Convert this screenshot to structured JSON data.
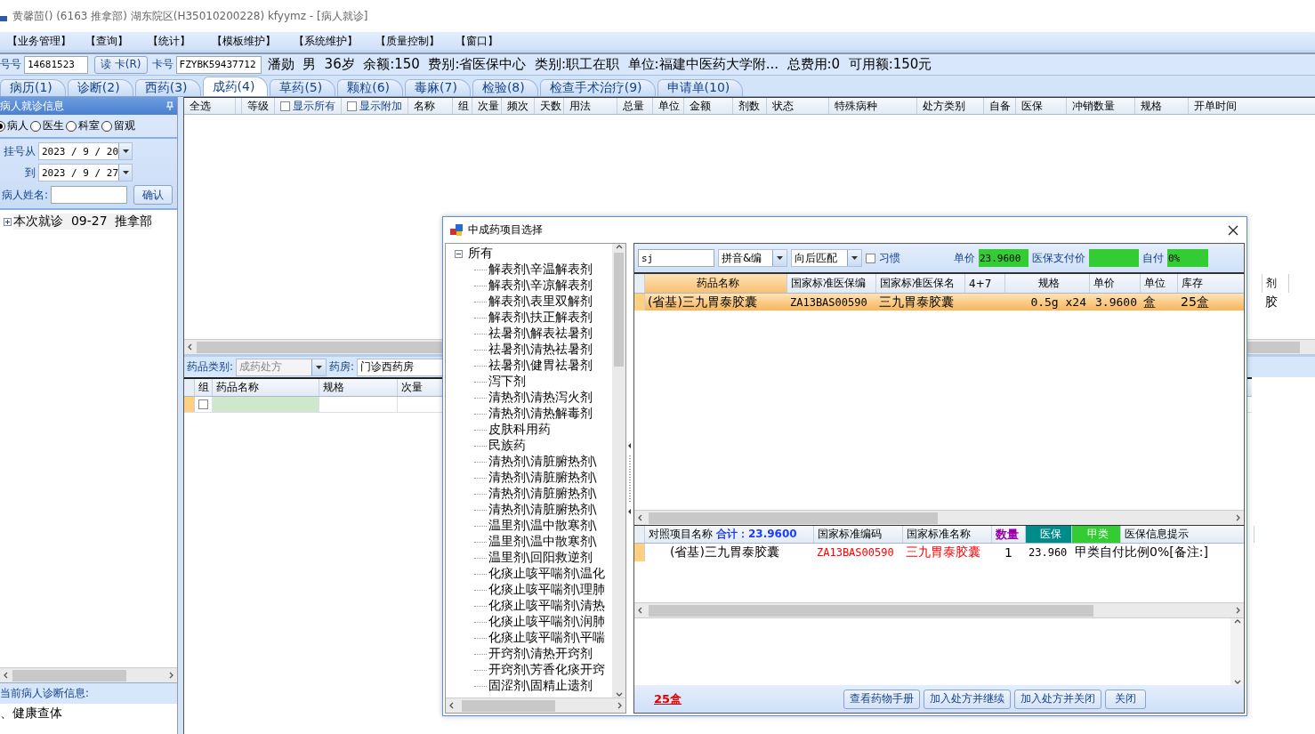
{
  "window": {
    "title": "黄馨茴() (6163 推拿部) 湖东院区(H35010200228) kfyymz - [病人就诊]"
  },
  "menu": [
    "【业务管理】",
    "【查询】",
    "【统计】",
    "【模板维护】",
    "【系统维护】",
    "【质量控制】",
    "【窗口】"
  ],
  "patient_bar": {
    "reg_label": "号号",
    "reg_value": "14681523",
    "read_card_button": "读 卡(R)",
    "card_label": "卡号",
    "card_value": "FZYBK59437712",
    "info": "潘勋  男  36岁  余额:150  费别:省医保中心  类别:职工在职  单位:福建中医药大学附...  总费用:0  可用额:150元"
  },
  "tabs": [
    {
      "label": "病历(1)",
      "selected": false
    },
    {
      "label": "诊断(2)",
      "selected": false
    },
    {
      "label": "西药(3)",
      "selected": false
    },
    {
      "label": "成药(4)",
      "selected": true
    },
    {
      "label": "草药(5)",
      "selected": false
    },
    {
      "label": "颗粒(6)",
      "selected": false
    },
    {
      "label": "毒麻(7)",
      "selected": false
    },
    {
      "label": "检验(8)",
      "selected": false
    },
    {
      "label": "检查手术治疗(9)",
      "selected": false
    },
    {
      "label": "申请单(10)",
      "selected": false
    }
  ],
  "left_panel": {
    "title": "病人就诊信息",
    "filters": [
      {
        "label": "病人",
        "selected": true
      },
      {
        "label": "医生",
        "selected": false
      },
      {
        "label": "科室",
        "selected": false
      },
      {
        "label": "留观",
        "selected": false
      }
    ],
    "date_from_label": "挂号从",
    "date_from": "2023 / 9 / 20",
    "date_to_label": "到",
    "date_to": "2023 / 9 / 27",
    "name_label": "病人姓名:",
    "confirm_button": "确认",
    "tree": [
      {
        "label": "本次就诊  09-27  推拿部",
        "expanded": false
      }
    ],
    "diagnosis_title": "当前病人诊断信息:",
    "diagnosis": "、健康查体"
  },
  "order_grid": {
    "columns": [
      {
        "kind": "text",
        "label": "全选"
      },
      {
        "kind": "text"
      },
      {
        "kind": "text",
        "label": "等级"
      },
      {
        "kind": "checkbox",
        "label": "显示所有",
        "checked": false
      },
      {
        "kind": "checkbox",
        "label": "显示附加",
        "checked": false
      },
      {
        "kind": "text",
        "label": "名称"
      },
      {
        "kind": "text",
        "label": "组"
      },
      {
        "kind": "text",
        "label": "次量"
      },
      {
        "kind": "text",
        "label": "频次"
      },
      {
        "kind": "text",
        "label": "天数"
      },
      {
        "kind": "text",
        "label": "用法"
      },
      {
        "kind": "text",
        "label": "总量"
      },
      {
        "kind": "text",
        "label": "单位"
      },
      {
        "kind": "text",
        "label": "金额"
      },
      {
        "kind": "text",
        "label": "剂数"
      },
      {
        "kind": "text",
        "label": "状态"
      },
      {
        "kind": "text",
        "label": "特殊病种"
      },
      {
        "kind": "text",
        "label": "处方类别"
      },
      {
        "kind": "text",
        "label": "自备"
      },
      {
        "kind": "text",
        "label": "医保"
      },
      {
        "kind": "text",
        "label": "冲销数量"
      },
      {
        "kind": "text",
        "label": "规格"
      },
      {
        "kind": "text",
        "label": "开单时间"
      }
    ]
  },
  "drug_panel": {
    "category_label": "药品类别:",
    "category": "成药处方",
    "pharmacy_label": "药房:",
    "pharmacy": "门诊西药房",
    "columns": [
      "组",
      "药品名称",
      "规格",
      "次量"
    ],
    "rows": [
      {
        "checked": false
      }
    ]
  },
  "dialog": {
    "title": "中成药项目选择",
    "tree": {
      "label": "所有",
      "expanded": true,
      "children": [
        {
          "label": "解表剂\\辛温解表剂"
        },
        {
          "label": "解表剂\\辛凉解表剂"
        },
        {
          "label": "解表剂\\表里双解剂"
        },
        {
          "label": "解表剂\\扶正解表剂"
        },
        {
          "label": "祛暑剂\\解表祛暑剂"
        },
        {
          "label": "祛暑剂\\清热祛暑剂"
        },
        {
          "label": "祛暑剂\\健胃祛暑剂"
        },
        {
          "label": "泻下剂"
        },
        {
          "label": "清热剂\\清热泻火剂"
        },
        {
          "label": "清热剂\\清热解毒剂"
        },
        {
          "label": "皮肤科用药"
        },
        {
          "label": "民族药"
        },
        {
          "label": "清热剂\\清脏腑热剂\\"
        },
        {
          "label": "清热剂\\清脏腑热剂\\"
        },
        {
          "label": "清热剂\\清脏腑热剂\\"
        },
        {
          "label": "清热剂\\清脏腑热剂\\"
        },
        {
          "label": "温里剂\\温中散寒剂\\"
        },
        {
          "label": "温里剂\\温中散寒剂\\"
        },
        {
          "label": "温里剂\\回阳救逆剂"
        },
        {
          "label": "化痰止咳平喘剂\\温化"
        },
        {
          "label": "化痰止咳平喘剂\\理肺"
        },
        {
          "label": "化痰止咳平喘剂\\清热"
        },
        {
          "label": "化痰止咳平喘剂\\润肺"
        },
        {
          "label": "化痰止咳平喘剂\\平喘"
        },
        {
          "label": "开窍剂\\清热开窍剂"
        },
        {
          "label": "开窍剂\\芳香化痰开窍"
        },
        {
          "label": "固涩剂\\固精止遗剂"
        }
      ]
    },
    "search": "sj",
    "match_mode": "拼音&编",
    "match_direction": "向后匹配",
    "habit": {
      "label": "习惯",
      "checked": false
    },
    "price_label": "单价",
    "price": "23.9600",
    "insurance_price_label": "医保支付价",
    "self_pay_label": "自付",
    "self_pay": "0%",
    "results": {
      "columns": [
        "药品名称",
        "国家标准医保编",
        "国家标准医保名",
        "4+7",
        "规格",
        "单价",
        "单位",
        "库存",
        "剂"
      ],
      "rows": [
        {
          "selected": true,
          "cells": [
            "(省基)三九胃泰胶囊",
            "ZA13BAS00590",
            "三九胃泰胶囊",
            "",
            "0.5g x24",
            "3.9600",
            "盒",
            "25盒",
            "胶"
          ]
        }
      ]
    },
    "lower": {
      "total": "合计：23.9600",
      "columns": [
        {
          "kind": "text",
          "label": "对照项目名称"
        },
        {
          "kind": "text",
          "label": "国家标准编码"
        },
        {
          "kind": "text",
          "label": "国家标准名称"
        },
        {
          "kind": "text",
          "label": "数量",
          "color": "#9900aa"
        },
        {
          "kind": "tag",
          "label": "医保",
          "color": "#008b8b"
        },
        {
          "kind": "tag",
          "label": "甲类",
          "color": "#33cc33"
        },
        {
          "kind": "text",
          "label": "医保信息提示"
        }
      ],
      "rows": [
        {
          "cells": [
            {
              "text": "(省基)三九胃泰胶囊"
            },
            {
              "text": "ZA13BAS00590",
              "color": "#ff0000"
            },
            {
              "text": "三九胃泰胶囊",
              "color": "#ff0000"
            },
            {
              "text": "1"
            },
            {
              "text": "23.960"
            },
            {
              "text": "甲类自付比例0%[备注:]"
            }
          ]
        }
      ]
    },
    "stock": "25盒",
    "buttons": [
      "查看药物手册",
      "加入处方并继续",
      "加入处方并关闭",
      "关闭"
    ]
  }
}
